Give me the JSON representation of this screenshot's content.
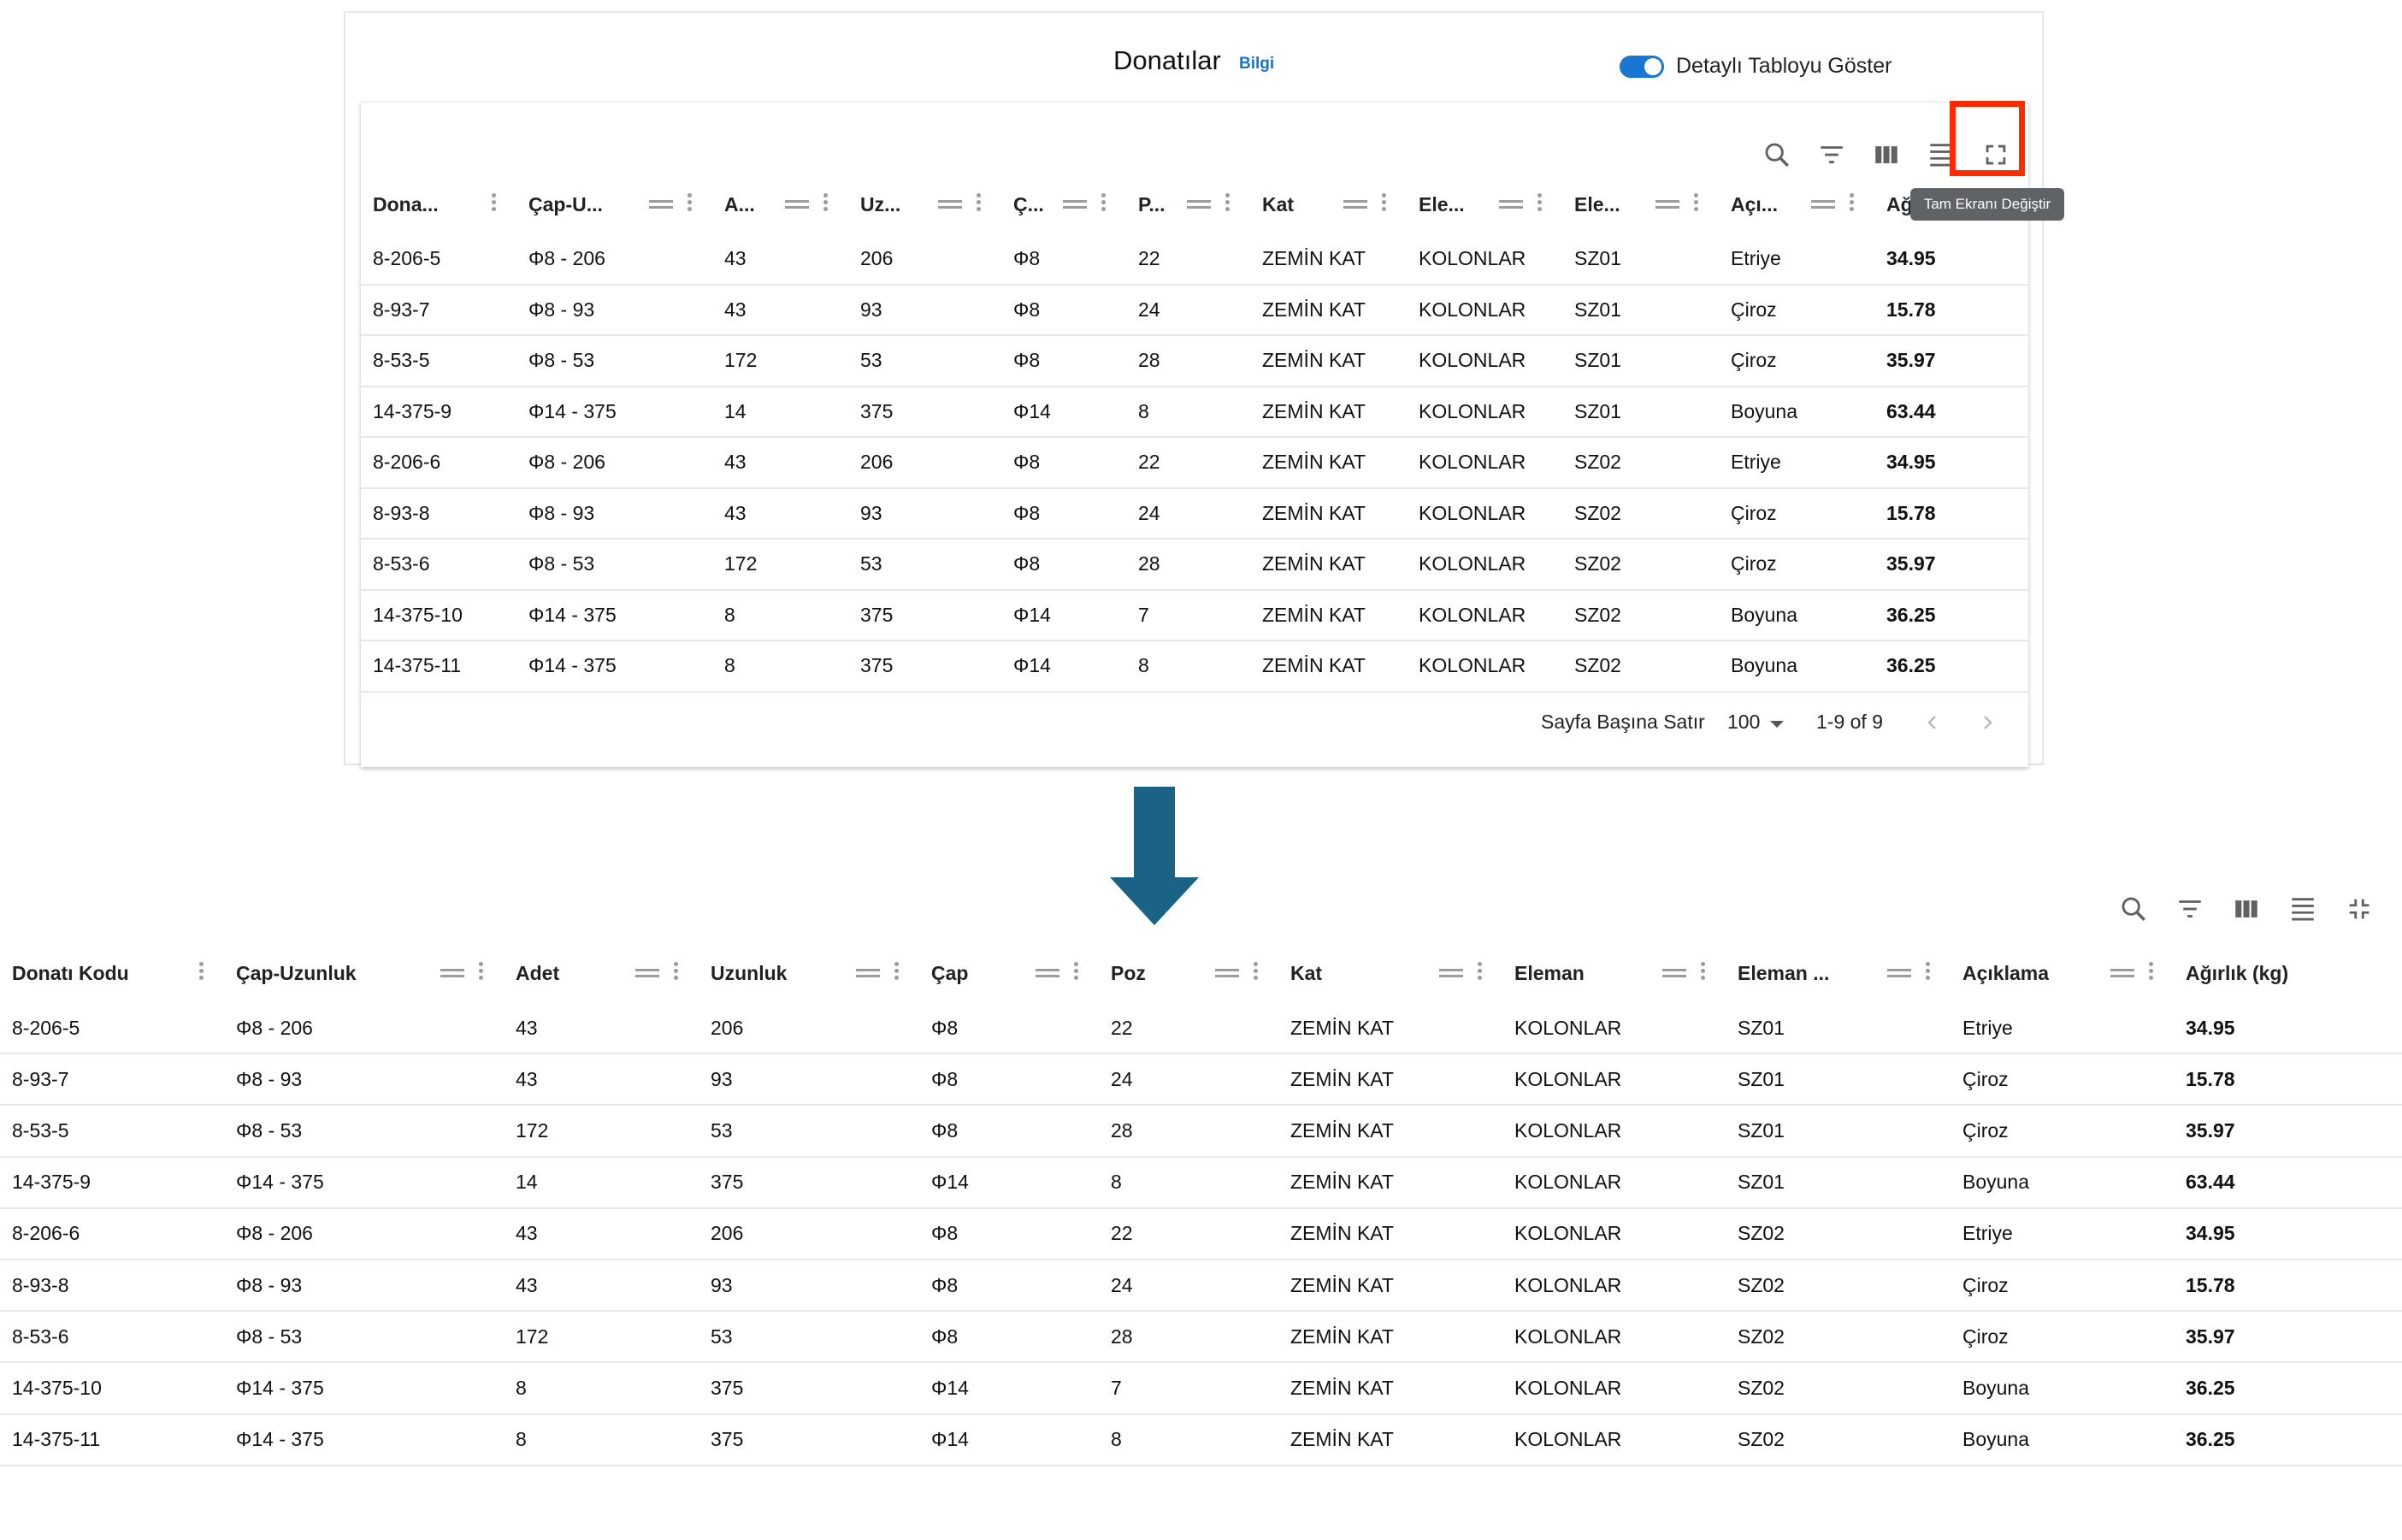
{
  "header": {
    "title": "Donatılar",
    "info_link": "Bilgi",
    "toggle_label": "Detaylı Tabloyu Göster",
    "toggle_on": true
  },
  "toolbar": {
    "icons": [
      "search-icon",
      "filter-icon",
      "columns-icon",
      "density-icon",
      "fullscreen-icon"
    ],
    "fullscreen_tooltip": "Tam Ekranı Değiştir"
  },
  "top_table": {
    "columns": [
      "Dona...",
      "Çap-U...",
      "A...",
      "Uz...",
      "Ç...",
      "P...",
      "Kat",
      "Ele...",
      "Ele...",
      "Açı...",
      "Ağ"
    ]
  },
  "full_table": {
    "columns": [
      "Donatı Kodu",
      "Çap-Uzunluk",
      "Adet",
      "Uzunluk",
      "Çap",
      "Poz",
      "Kat",
      "Eleman",
      "Eleman ...",
      "Açıklama",
      "Ağırlık (kg)"
    ]
  },
  "rows": [
    [
      "8-206-5",
      "Φ8 - 206",
      "43",
      "206",
      "Φ8",
      "22",
      "ZEMİN KAT",
      "KOLONLAR",
      "SZ01",
      "Etriye",
      "34.95"
    ],
    [
      "8-93-7",
      "Φ8 - 93",
      "43",
      "93",
      "Φ8",
      "24",
      "ZEMİN KAT",
      "KOLONLAR",
      "SZ01",
      "Çiroz",
      "15.78"
    ],
    [
      "8-53-5",
      "Φ8 - 53",
      "172",
      "53",
      "Φ8",
      "28",
      "ZEMİN KAT",
      "KOLONLAR",
      "SZ01",
      "Çiroz",
      "35.97"
    ],
    [
      "14-375-9",
      "Φ14 - 375",
      "14",
      "375",
      "Φ14",
      "8",
      "ZEMİN KAT",
      "KOLONLAR",
      "SZ01",
      "Boyuna",
      "63.44"
    ],
    [
      "8-206-6",
      "Φ8 - 206",
      "43",
      "206",
      "Φ8",
      "22",
      "ZEMİN KAT",
      "KOLONLAR",
      "SZ02",
      "Etriye",
      "34.95"
    ],
    [
      "8-93-8",
      "Φ8 - 93",
      "43",
      "93",
      "Φ8",
      "24",
      "ZEMİN KAT",
      "KOLONLAR",
      "SZ02",
      "Çiroz",
      "15.78"
    ],
    [
      "8-53-6",
      "Φ8 - 53",
      "172",
      "53",
      "Φ8",
      "28",
      "ZEMİN KAT",
      "KOLONLAR",
      "SZ02",
      "Çiroz",
      "35.97"
    ],
    [
      "14-375-10",
      "Φ14 - 375",
      "8",
      "375",
      "Φ14",
      "7",
      "ZEMİN KAT",
      "KOLONLAR",
      "SZ02",
      "Boyuna",
      "36.25"
    ],
    [
      "14-375-11",
      "Φ14 - 375",
      "8",
      "375",
      "Φ14",
      "8",
      "ZEMİN KAT",
      "KOLONLAR",
      "SZ02",
      "Boyuna",
      "36.25"
    ]
  ],
  "pagination": {
    "rows_per_page_label": "Sayfa Başına Satır",
    "rows_per_page_value": "100",
    "range": "1-9 of 9"
  },
  "colors": {
    "accent": "#1976d2",
    "highlight": "#ff2a00",
    "arrow": "#1b6287",
    "tooltip_bg": "#5f6368"
  }
}
